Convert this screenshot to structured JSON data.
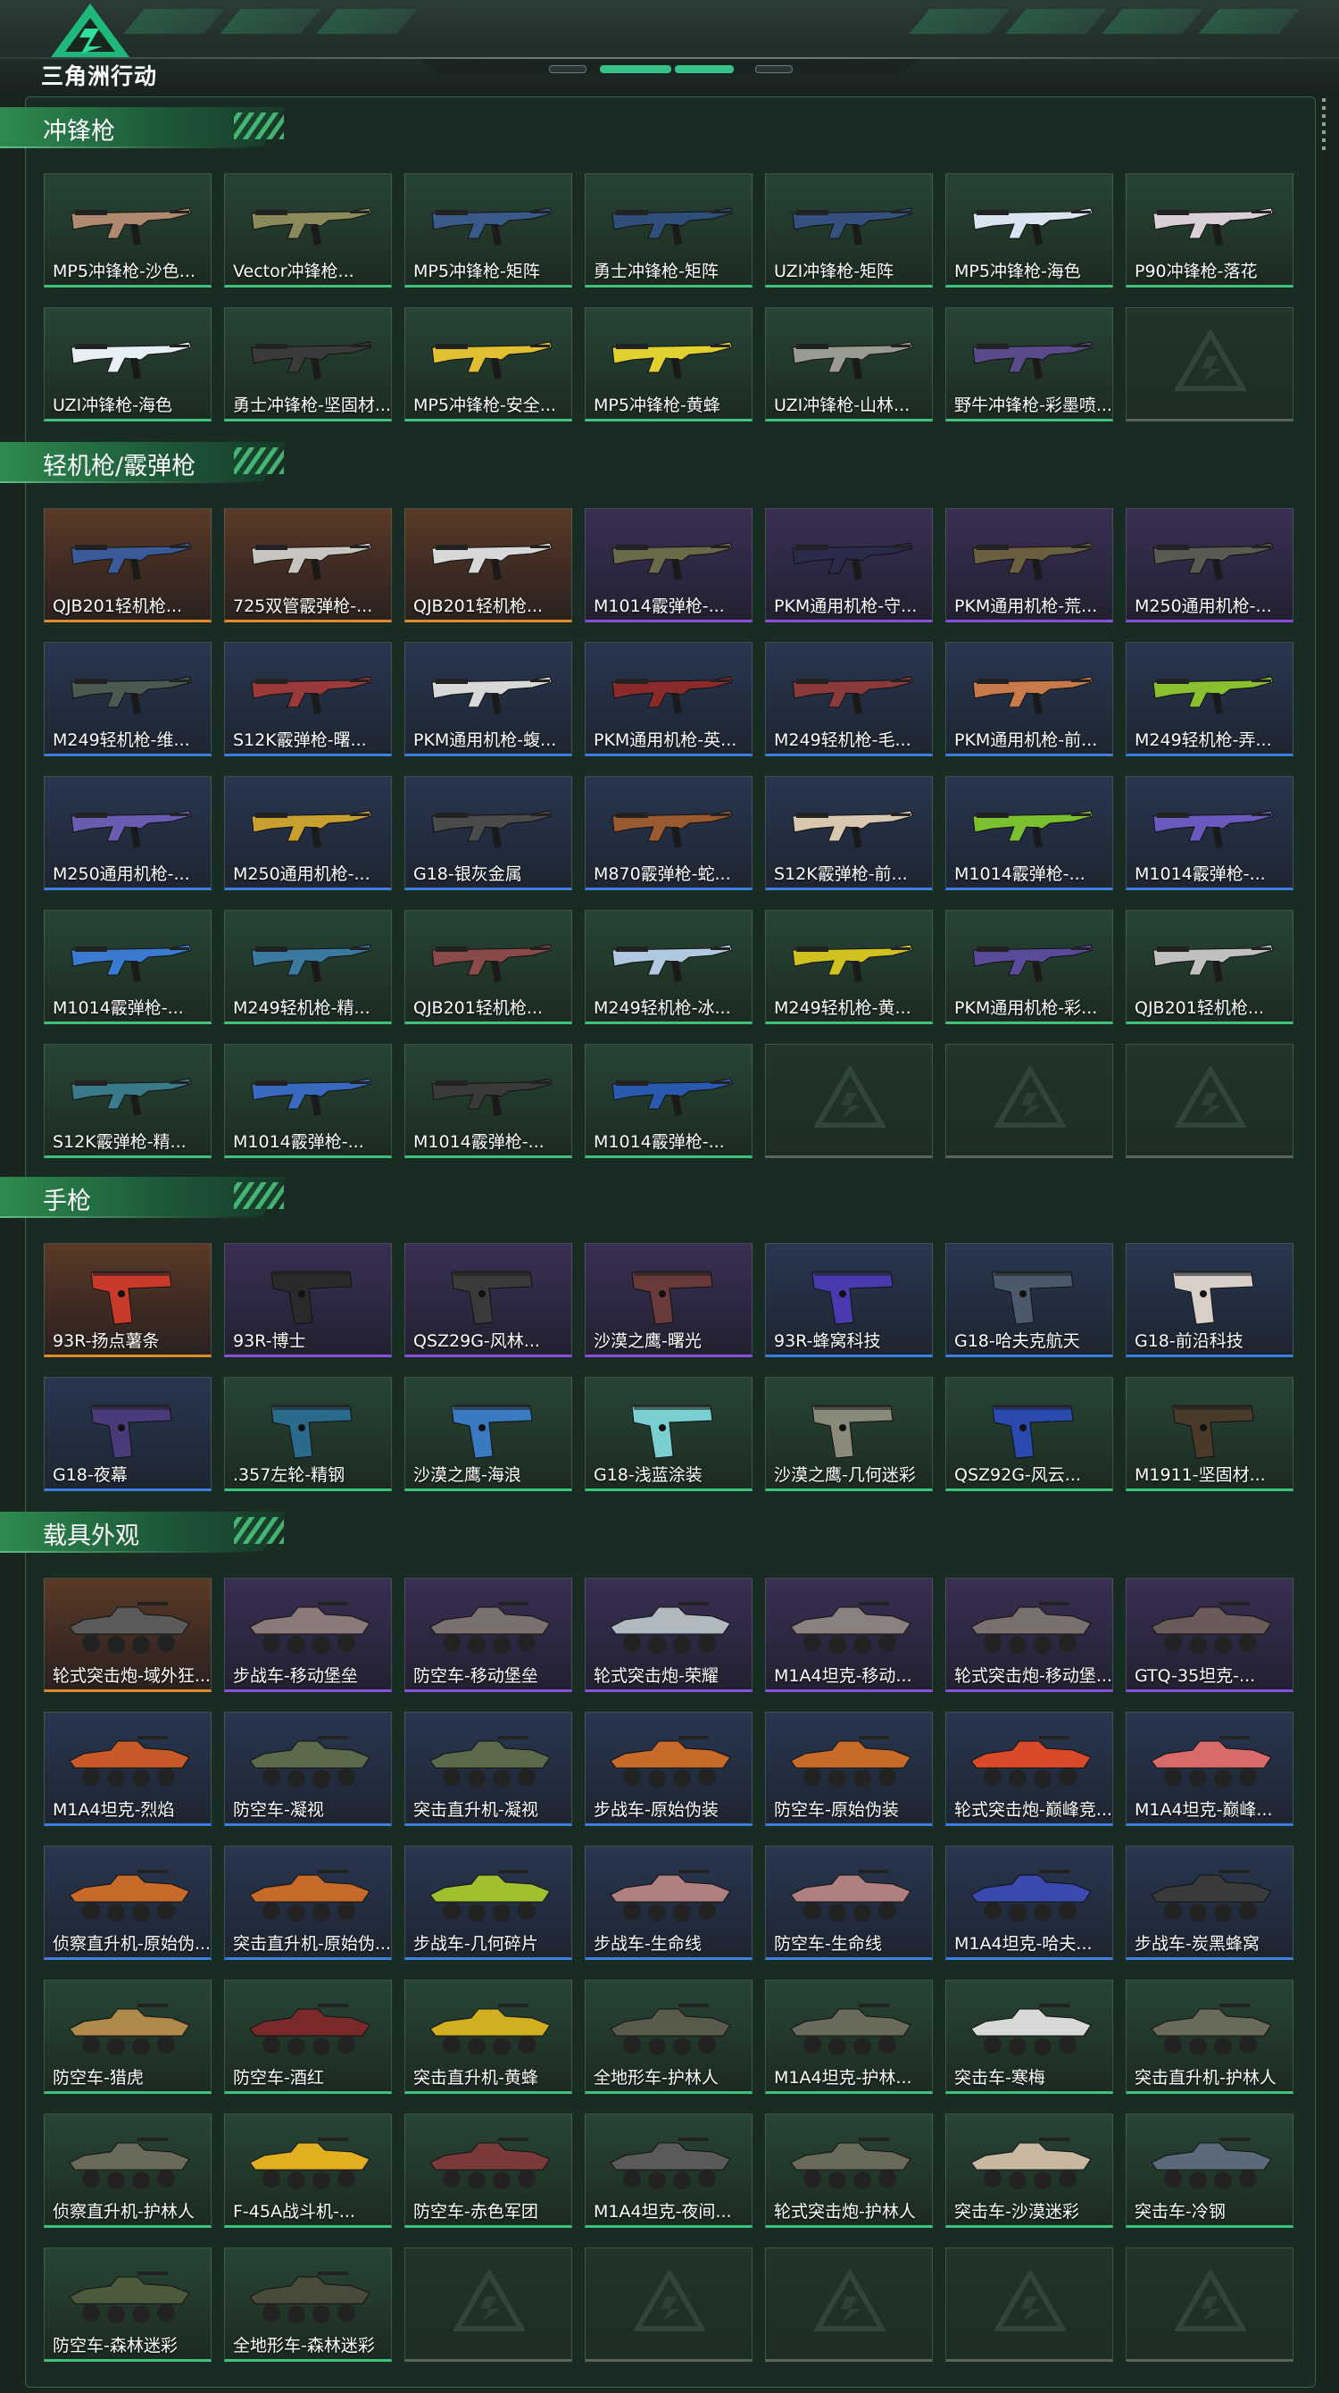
{
  "header": {
    "logo_text": "三角洲行动"
  },
  "sections": [
    {
      "title": "冲锋枪",
      "kind": "gun",
      "items": [
        {
          "label": "MP5冲锋枪-沙色...",
          "rarity": "green",
          "color": "#b08a6e"
        },
        {
          "label": "Vector冲锋枪...",
          "rarity": "green",
          "color": "#8a8a5a"
        },
        {
          "label": "MP5冲锋枪-矩阵",
          "rarity": "green",
          "color": "#3a5a8a"
        },
        {
          "label": "勇士冲锋枪-矩阵",
          "rarity": "green",
          "color": "#2f4f7a"
        },
        {
          "label": "UZI冲锋枪-矩阵",
          "rarity": "green",
          "color": "#34507e"
        },
        {
          "label": "MP5冲锋枪-海色",
          "rarity": "green",
          "color": "#d8e4f0"
        },
        {
          "label": "P90冲锋枪-落花",
          "rarity": "green",
          "color": "#d8d0d6"
        },
        {
          "label": "UZI冲锋枪-海色",
          "rarity": "green",
          "color": "#e8eef5"
        },
        {
          "label": "勇士冲锋枪-坚固材...",
          "rarity": "green",
          "color": "#3a3a3a"
        },
        {
          "label": "MP5冲锋枪-安全...",
          "rarity": "green",
          "color": "#e0c030"
        },
        {
          "label": "MP5冲锋枪-黄蜂",
          "rarity": "green",
          "color": "#e2d030"
        },
        {
          "label": "UZI冲锋枪-山林...",
          "rarity": "green",
          "color": "#9a9a90"
        },
        {
          "label": "野牛冲锋枪-彩墨喷...",
          "rarity": "green",
          "color": "#5a4a8a"
        },
        {
          "label": "",
          "rarity": "empty"
        }
      ]
    },
    {
      "title": "轻机枪/霰弹枪",
      "kind": "gun",
      "items": [
        {
          "label": "QJB201轻机枪...",
          "rarity": "orange",
          "color": "#3a5a9a"
        },
        {
          "label": "725双管霰弹枪-...",
          "rarity": "orange",
          "color": "#c8c4c0"
        },
        {
          "label": "QJB201轻机枪...",
          "rarity": "orange",
          "color": "#d8d8d8"
        },
        {
          "label": "M1014霰弹枪-...",
          "rarity": "purple",
          "color": "#6a6a4a"
        },
        {
          "label": "PKM通用机枪-守...",
          "rarity": "purple",
          "color": "#2a2a4a"
        },
        {
          "label": "PKM通用机枪-荒...",
          "rarity": "purple",
          "color": "#6a6040"
        },
        {
          "label": "M250通用机枪-...",
          "rarity": "purple",
          "color": "#5a5a50"
        },
        {
          "label": "M249轻机枪-维...",
          "rarity": "blue",
          "color": "#4a5a50"
        },
        {
          "label": "S12K霰弹枪-曙...",
          "rarity": "blue",
          "color": "#9a3a3a"
        },
        {
          "label": "PKM通用机枪-蝮...",
          "rarity": "blue",
          "color": "#d8d8d8"
        },
        {
          "label": "PKM通用机枪-英...",
          "rarity": "blue",
          "color": "#8a2a2a"
        },
        {
          "label": "M249轻机枪-毛...",
          "rarity": "blue",
          "color": "#8a3a3a"
        },
        {
          "label": "PKM通用机枪-前...",
          "rarity": "blue",
          "color": "#c87a4a"
        },
        {
          "label": "M249轻机枪-弄...",
          "rarity": "blue",
          "color": "#8ac030"
        },
        {
          "label": "M250通用机枪-...",
          "rarity": "blue",
          "color": "#6a5ab0"
        },
        {
          "label": "M250通用机枪-...",
          "rarity": "blue",
          "color": "#c8a030"
        },
        {
          "label": "G18-银灰金属",
          "rarity": "blue",
          "color": "#4a4a4a"
        },
        {
          "label": "M870霰弹枪-蛇...",
          "rarity": "blue",
          "color": "#9a5a30"
        },
        {
          "label": "S12K霰弹枪-前...",
          "rarity": "blue",
          "color": "#d8c8b0"
        },
        {
          "label": "M1014霰弹枪-...",
          "rarity": "blue",
          "color": "#7ac030"
        },
        {
          "label": "M1014霰弹枪-...",
          "rarity": "blue",
          "color": "#6a5ac0"
        },
        {
          "label": "M1014霰弹枪-...",
          "rarity": "green",
          "color": "#3a7ad0"
        },
        {
          "label": "M249轻机枪-精...",
          "rarity": "green",
          "color": "#3a7aa0"
        },
        {
          "label": "QJB201轻机枪...",
          "rarity": "green",
          "color": "#8a4a4a"
        },
        {
          "label": "M249轻机枪-冰...",
          "rarity": "green",
          "color": "#b0c8e0"
        },
        {
          "label": "M249轻机枪-黄...",
          "rarity": "green",
          "color": "#d0c020"
        },
        {
          "label": "PKM通用机枪-彩...",
          "rarity": "green",
          "color": "#5a4a9a"
        },
        {
          "label": "QJB201轻机枪...",
          "rarity": "green",
          "color": "#c0c0c0"
        },
        {
          "label": "S12K霰弹枪-精...",
          "rarity": "green",
          "color": "#3a7a8a"
        },
        {
          "label": "M1014霰弹枪-...",
          "rarity": "green",
          "color": "#3a6ac0"
        },
        {
          "label": "M1014霰弹枪-...",
          "rarity": "green",
          "color": "#3a3a3a"
        },
        {
          "label": "M1014霰弹枪-...",
          "rarity": "green",
          "color": "#2a5ab0"
        },
        {
          "label": "",
          "rarity": "empty"
        },
        {
          "label": "",
          "rarity": "empty"
        },
        {
          "label": "",
          "rarity": "empty"
        }
      ]
    },
    {
      "title": "手枪",
      "kind": "pistol",
      "items": [
        {
          "label": "93R-扬点薯条",
          "rarity": "orange",
          "color": "#c83a2a"
        },
        {
          "label": "93R-博士",
          "rarity": "purple",
          "color": "#2a2a2a"
        },
        {
          "label": "QSZ29G-风林...",
          "rarity": "purple",
          "color": "#3a3a3a"
        },
        {
          "label": "沙漠之鹰-曙光",
          "rarity": "purple",
          "color": "#6a3a3a"
        },
        {
          "label": "93R-蜂窝科技",
          "rarity": "blue",
          "color": "#4a3ab0"
        },
        {
          "label": "G18-哈夫克航天",
          "rarity": "blue",
          "color": "#4a5a6a"
        },
        {
          "label": "G18-前沿科技",
          "rarity": "blue",
          "color": "#d8d0c8"
        },
        {
          "label": "G18-夜幕",
          "rarity": "blue",
          "color": "#4a3a7a"
        },
        {
          "label": ".357左轮-精钢",
          "rarity": "green",
          "color": "#2a6a8a"
        },
        {
          "label": "沙漠之鹰-海浪",
          "rarity": "green",
          "color": "#3a7ac0"
        },
        {
          "label": "G18-浅蓝涂装",
          "rarity": "green",
          "color": "#7ad0d0"
        },
        {
          "label": "沙漠之鹰-几何迷彩",
          "rarity": "green",
          "color": "#8a8a7a"
        },
        {
          "label": "QSZ92G-风云...",
          "rarity": "green",
          "color": "#2a4ab0"
        },
        {
          "label": "M1911-坚固材...",
          "rarity": "green",
          "color": "#4a3a2a"
        }
      ]
    },
    {
      "title": "载具外观",
      "kind": "vehicle",
      "items": [
        {
          "label": "轮式突击炮-域外狂...",
          "rarity": "orange",
          "color": "#5a5a5a"
        },
        {
          "label": "步战车-移动堡垒",
          "rarity": "purple",
          "color": "#8a7a7a"
        },
        {
          "label": "防空车-移动堡垒",
          "rarity": "purple",
          "color": "#7a7070"
        },
        {
          "label": "轮式突击炮-荣耀",
          "rarity": "purple",
          "color": "#b0b8c0"
        },
        {
          "label": "M1A4坦克-移动...",
          "rarity": "purple",
          "color": "#8a8080"
        },
        {
          "label": "轮式突击炮-移动堡...",
          "rarity": "purple",
          "color": "#7a7070"
        },
        {
          "label": "GTQ-35坦克-...",
          "rarity": "purple",
          "color": "#6a5a5a"
        },
        {
          "label": "M1A4坦克-烈焰",
          "rarity": "blue",
          "color": "#c85a2a"
        },
        {
          "label": "防空车-凝视",
          "rarity": "blue",
          "color": "#5a6a4a"
        },
        {
          "label": "突击直升机-凝视",
          "rarity": "blue",
          "color": "#5a6a4a"
        },
        {
          "label": "步战车-原始伪装",
          "rarity": "blue",
          "color": "#c86a2a"
        },
        {
          "label": "防空车-原始伪装",
          "rarity": "blue",
          "color": "#c86a2a"
        },
        {
          "label": "轮式突击炮-巅峰竞...",
          "rarity": "blue",
          "color": "#d84a2a"
        },
        {
          "label": "M1A4坦克-巅峰...",
          "rarity": "blue",
          "color": "#d86a6a"
        },
        {
          "label": "侦察直升机-原始伪...",
          "rarity": "blue",
          "color": "#c86a2a"
        },
        {
          "label": "突击直升机-原始伪...",
          "rarity": "blue",
          "color": "#c86a2a"
        },
        {
          "label": "步战车-几何碎片",
          "rarity": "blue",
          "color": "#a0c030"
        },
        {
          "label": "步战车-生命线",
          "rarity": "blue",
          "color": "#b08080"
        },
        {
          "label": "防空车-生命线",
          "rarity": "blue",
          "color": "#b08080"
        },
        {
          "label": "M1A4坦克-哈夫...",
          "rarity": "blue",
          "color": "#3a4ab0"
        },
        {
          "label": "步战车-炭黑蜂窝",
          "rarity": "blue",
          "color": "#3a3a3a"
        },
        {
          "label": "防空车-猎虎",
          "rarity": "green",
          "color": "#b08a4a"
        },
        {
          "label": "防空车-酒红",
          "rarity": "green",
          "color": "#7a2a2a"
        },
        {
          "label": "突击直升机-黄蜂",
          "rarity": "green",
          "color": "#d0b020"
        },
        {
          "label": "全地形车-护林人",
          "rarity": "green",
          "color": "#5a5a4a"
        },
        {
          "label": "M1A4坦克-护林...",
          "rarity": "green",
          "color": "#6a6a5a"
        },
        {
          "label": "突击车-寒梅",
          "rarity": "green",
          "color": "#d8d8d8"
        },
        {
          "label": "突击直升机-护林人",
          "rarity": "green",
          "color": "#6a6a5a"
        },
        {
          "label": "侦察直升机-护林人",
          "rarity": "green",
          "color": "#6a6a5a"
        },
        {
          "label": "F-45A战斗机-...",
          "rarity": "green",
          "color": "#e0b020"
        },
        {
          "label": "防空车-赤色军团",
          "rarity": "green",
          "color": "#7a3a3a"
        },
        {
          "label": "M1A4坦克-夜间...",
          "rarity": "green",
          "color": "#5a5a5a"
        },
        {
          "label": "轮式突击炮-护林人",
          "rarity": "green",
          "color": "#6a6a5a"
        },
        {
          "label": "突击车-沙漠迷彩",
          "rarity": "green",
          "color": "#c8b8a0"
        },
        {
          "label": "突击车-冷钢",
          "rarity": "green",
          "color": "#5a6a7a"
        },
        {
          "label": "防空车-森林迷彩",
          "rarity": "green",
          "color": "#4a5a3a"
        },
        {
          "label": "全地形车-森林迷彩",
          "rarity": "green",
          "color": "#4a4a3a"
        },
        {
          "label": "",
          "rarity": "empty"
        },
        {
          "label": "",
          "rarity": "empty"
        },
        {
          "label": "",
          "rarity": "empty"
        },
        {
          "label": "",
          "rarity": "empty"
        },
        {
          "label": "",
          "rarity": "empty"
        }
      ]
    }
  ]
}
